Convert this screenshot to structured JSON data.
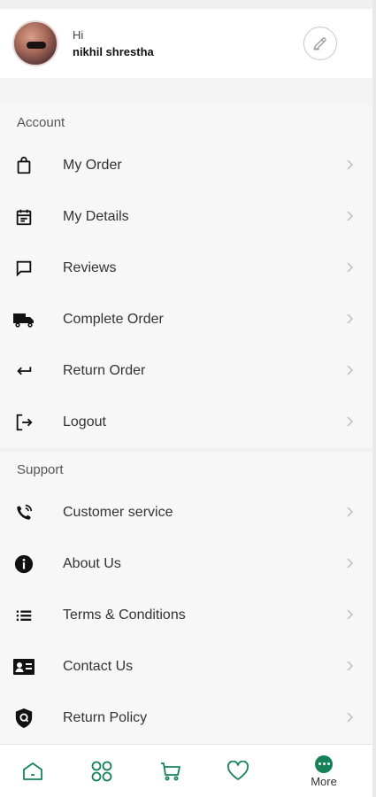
{
  "header": {
    "greeting": "Hi",
    "user_name": "nikhil shrestha"
  },
  "sections": {
    "account": {
      "title": "Account",
      "items": [
        {
          "label": "My Order",
          "icon": "shopping-bag-icon"
        },
        {
          "label": "My Details",
          "icon": "calendar-icon"
        },
        {
          "label": "Reviews",
          "icon": "chat-bubble-icon"
        },
        {
          "label": "Complete Order",
          "icon": "truck-icon"
        },
        {
          "label": "Return Order",
          "icon": "return-arrow-icon"
        },
        {
          "label": "Logout",
          "icon": "logout-icon"
        }
      ]
    },
    "support": {
      "title": "Support",
      "items": [
        {
          "label": "Customer service",
          "icon": "phone-icon"
        },
        {
          "label": "About Us",
          "icon": "info-icon"
        },
        {
          "label": "Terms & Conditions",
          "icon": "list-icon"
        },
        {
          "label": "Contact Us",
          "icon": "contact-card-icon"
        },
        {
          "label": "Return Policy",
          "icon": "shield-icon"
        }
      ]
    }
  },
  "bottom_nav": {
    "more_label": "More",
    "accent_color": "#15825a",
    "items": [
      "home-icon",
      "grid-icon",
      "cart-icon",
      "heart-icon",
      "more-icon"
    ]
  }
}
